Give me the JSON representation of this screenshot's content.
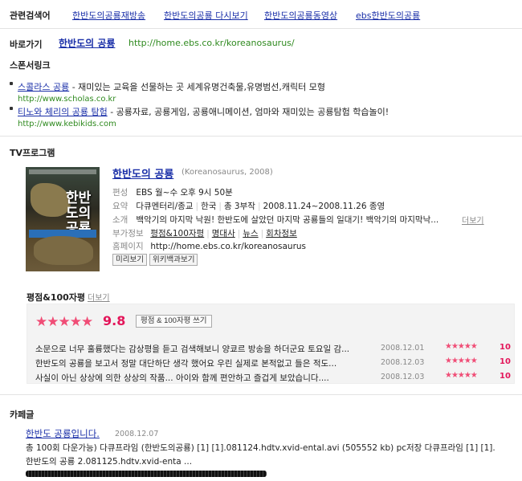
{
  "related": {
    "label": "관련검색어",
    "keywords": [
      "한반도의공룡재방송",
      "한반도의공룡 다시보기",
      "한반도의공룡동영상",
      "ebs한반도의공룡"
    ]
  },
  "shortcut": {
    "label": "바로가기",
    "title": "한반도의 공룡",
    "url": "http://home.ebs.co.kr/koreanosaurus/"
  },
  "sponsor": {
    "title": "스폰서링크",
    "items": [
      {
        "title": "스콜라스 공룡",
        "desc": " - 재미있는 교육을 선물하는 곳 세계유명건축물,유명범선,캐릭터 모형",
        "url": "http://www.scholas.co.kr"
      },
      {
        "title": "티노와 체리의 공룡 탐험",
        "desc": " - 공룡자료, 공룡게임, 공룡애니메이션, 엄마와 재미있는 공룡탐험 학습놀이!",
        "url": "http://www.kebikids.com"
      }
    ]
  },
  "tv": {
    "title": "TV프로그램",
    "poster": {
      "title": "한반도의 공룡"
    },
    "program_title": "한반도의 공룡",
    "program_sub": "(Koreanosaurus, 2008)",
    "info": {
      "k1": "편성",
      "v1": "EBS 월~수 오후 9시 50분",
      "k2": "요약",
      "v2a": "다큐멘터리/종교",
      "v2b": "한국",
      "v2c": "총 3부작",
      "v2d": "2008.11.24~2008.11.26 종영",
      "k3": "소개",
      "v3": "백악기의 마지막 낙원! 한반도에 살았던 마지막 공룡들의 일대기! 백악기의 마지막낙...",
      "v3more": "더보기",
      "k4": "부가정보",
      "v4a": "평점&100자평",
      "v4b": "명대사",
      "v4c": "뉴스",
      "v4d": "회차정보",
      "k5": "홈페이지",
      "v5": "http://home.ebs.co.kr/koreanosaurus"
    },
    "btn_preview": "미리보기",
    "btn_wiki": "위키백과보기"
  },
  "review": {
    "heading": "평점&100자평",
    "more": "더보기",
    "stars": "★★★★★",
    "score": "9.8",
    "write_btn": "평점 & 100자평 쓰기",
    "rows": [
      {
        "text": "소문으로 너무 훌륭했다는 감상평을 듣고 검색해보니 양쿄르 방송을 하더군요 토요일 감...",
        "date": "2008.12.01",
        "stars": "★★★★★",
        "score": "10"
      },
      {
        "text": "한반도의 공룡을 보고서 정말 대단하단 생각 했어요 우린 실제로 본적없고 들은 적도...",
        "date": "2008.12.03",
        "stars": "★★★★★",
        "score": "10"
      },
      {
        "text": "사실이 아닌 상상에 의한 상상의 작품... 아이와 함께 편안하고 즐겁게 보았습니다....",
        "date": "2008.12.03",
        "stars": "★★★★★",
        "score": "10"
      }
    ]
  },
  "cafe": {
    "title": "카페글",
    "post_title": "한반도 공룡입니다.",
    "post_date": "2008.12.07",
    "line1": "총 100회 다운가능) 다큐프라임 (한반도의공룡) [1] [1].081124.hdtv.xvid-ental.avi (505552 kb) pc저장 다큐프라임 [1] [1].",
    "line2": "한반도의 공룡 2.081125.hdtv.xvid-enta ..."
  }
}
